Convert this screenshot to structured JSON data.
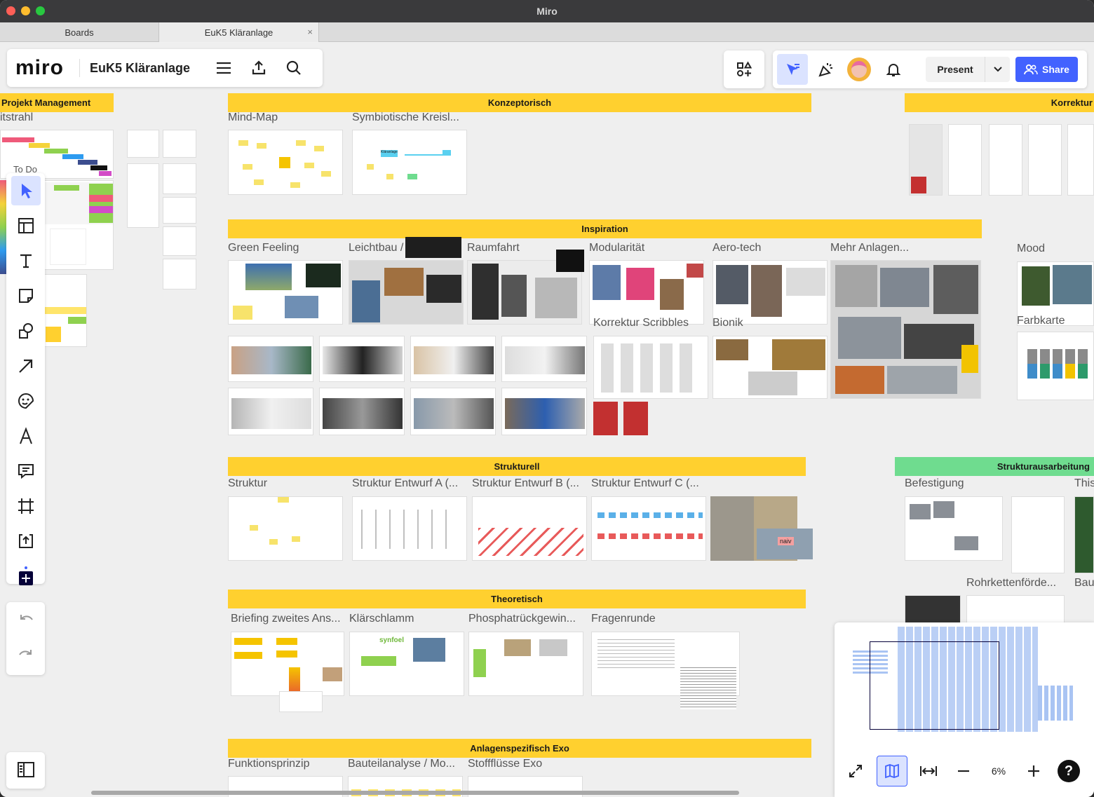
{
  "window": {
    "title": "Miro",
    "traffic": {
      "close": "#ff5f57",
      "min": "#febc2e",
      "max": "#28c840"
    }
  },
  "tabs": [
    {
      "label": "Boards"
    },
    {
      "label": "EuK5 Kläranlage",
      "close": "×"
    }
  ],
  "header": {
    "logo": "miro",
    "board_name": "EuK5 Kläranlage",
    "present_label": "Present",
    "share_label": "Share",
    "accent": "#4262ff"
  },
  "sections": {
    "projekt": "Projekt Management",
    "konzept": "Konzeptorisch",
    "korrektur": "Korrektur",
    "inspiration": "Inspiration",
    "strukturell": "Strukturell",
    "strukturausarbeitung": "Strukturausarbeitung",
    "theoretisch": "Theoretisch",
    "anlagen": "Anlagenspezifisch Exo",
    "yellow": "#ffd02f",
    "green": "#6fdc8f"
  },
  "frames": {
    "itstrahl": "itstrahl",
    "todo": "To Do",
    "mindmap": "Mind-Map",
    "symbiotische": "Symbiotische Kreisl...",
    "kreis_node": "Kläranlage",
    "green_feeling": "Green Feeling",
    "leichtbau": "Leichtbau / Umenfü...",
    "raumfahrt": "Raumfahrt",
    "modularitaet": "Modularität",
    "aero_tech": "Aero-tech",
    "mehr_anlagen": "Mehr Anlagen...",
    "mood": "Mood",
    "korrektur_scribbles": "Korrektur Scribbles",
    "bionik": "Bionik",
    "farbkarte": "Farbkarte",
    "struktur": "Struktur",
    "struktur_a": "Struktur Entwurf A (...",
    "struktur_b": "Struktur Entwurf B (...",
    "struktur_c": "Struktur Entwurf C (...",
    "naiv": "naiv",
    "befestigung": "Befestigung",
    "this": "This",
    "rohrketten": "Rohrkettenförde...",
    "bau": "Bau",
    "briefing": "Briefing zweites Ans...",
    "klaerschlamm": "Klärschlamm",
    "synfoel": "synfoel",
    "phosphat": "Phosphatrückgewin...",
    "fragenrunde": "Fragenrunde",
    "funktionsprinzip": "Funktionsprinzip",
    "bauteilanalyse": "Bauteilanalyse / Mo...",
    "stoffflusse": "Stoffflüsse Exo"
  },
  "zoom": {
    "level": "6%",
    "help": "?"
  },
  "icons": [
    "select-icon",
    "templates-icon",
    "text-icon",
    "sticky-note-icon",
    "shapes-icon",
    "arrow-icon",
    "sticker-icon",
    "pen-icon",
    "comment-icon",
    "frame-icon",
    "upload-icon",
    "add-apps-icon",
    "undo-icon",
    "redo-icon",
    "panel-icon",
    "menu-icon",
    "export-icon",
    "search-icon",
    "apps-icon",
    "cursor-icon",
    "celebrate-icon",
    "bell-icon",
    "chevron-down-icon",
    "users-icon",
    "fit-icon",
    "map-icon",
    "fit-width-icon",
    "zoom-out-icon",
    "zoom-in-icon",
    "help-icon"
  ]
}
